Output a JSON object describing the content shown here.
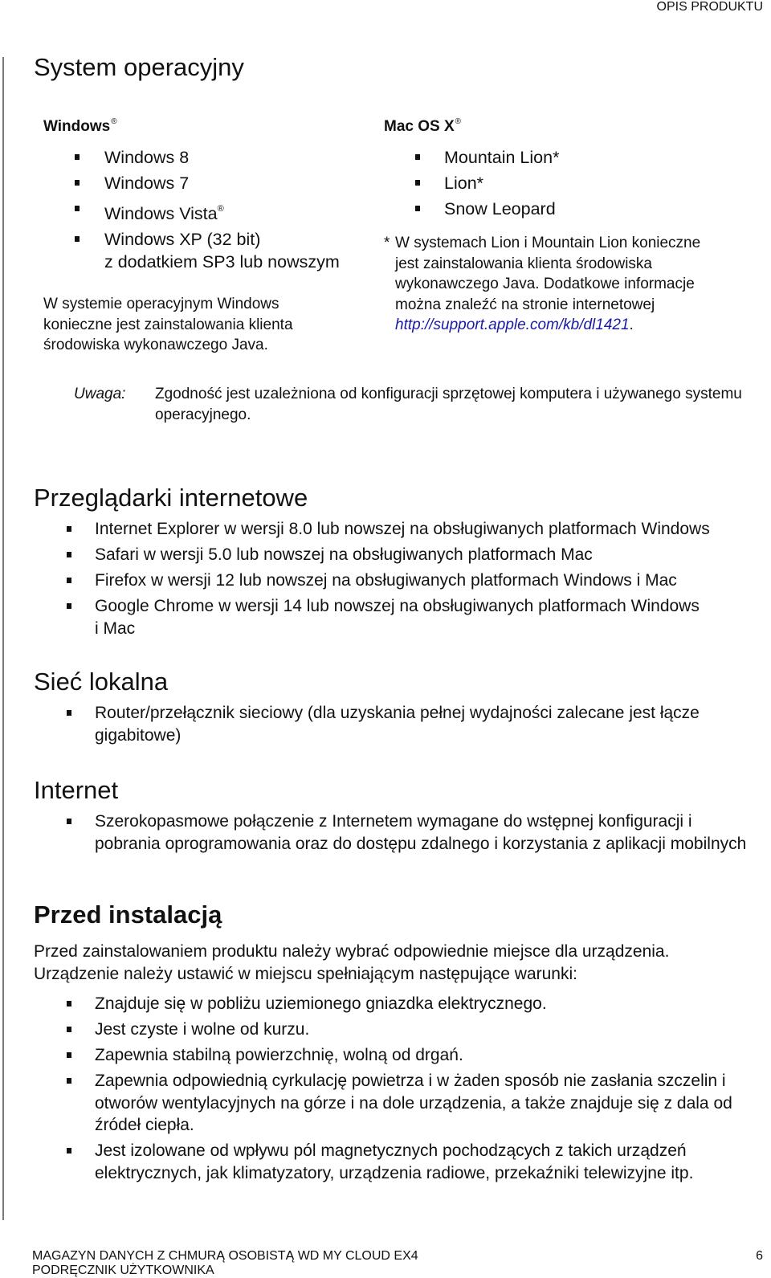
{
  "header": {
    "running_title": "OPIS PRODUKTU"
  },
  "sections": {
    "os": {
      "title": "System operacyjny",
      "windows": {
        "title": "Windows",
        "title_mark": "®",
        "items": [
          {
            "text": "Windows 8",
            "mark": ""
          },
          {
            "text": "Windows 7",
            "mark": ""
          },
          {
            "text": "Windows Vista",
            "mark": "®"
          },
          {
            "text": "Windows XP (32 bit)",
            "line2": "z dodatkiem SP3 lub nowszym",
            "mark": ""
          }
        ],
        "note_lines": [
          "W systemie operacyjnym Windows",
          "konieczne jest zainstalowania klienta",
          "środowiska wykonawczego Java."
        ]
      },
      "mac": {
        "title": "Mac OS X",
        "title_mark": "®",
        "items": [
          "Mountain Lion*",
          "Lion*",
          "Snow Leopard"
        ],
        "footnote_marker": "*",
        "footnote_lines": [
          "W systemach Lion i Mountain Lion konieczne",
          "jest zainstalowania klienta środowiska",
          "wykonawczego Java. Dodatkowe informacje",
          "można znaleźć na stronie internetowej"
        ],
        "link_text": "http://support.apple.com/kb/dl1421",
        "link_suffix": "."
      },
      "note": {
        "label": "Uwaga:",
        "text": "Zgodność jest uzależniona od konfiguracji sprzętowej komputera i używanego systemu operacyjnego."
      }
    },
    "browsers": {
      "title": "Przeglądarki internetowe",
      "items": [
        "Internet Explorer w wersji 8.0 lub nowszej na obsługiwanych platformach Windows",
        "Safari w wersji 5.0 lub nowszej na obsługiwanych platformach Mac",
        "Firefox w wersji 12 lub nowszej na obsługiwanych platformach Windows i Mac",
        "Google Chrome w wersji 14 lub nowszej na obsługiwanych platformach Windows i Mac"
      ]
    },
    "lan": {
      "title": "Sieć lokalna",
      "items": [
        "Router/przełącznik sieciowy (dla uzyskania pełnej wydajności zalecane jest łącze gigabitowe)"
      ]
    },
    "internet": {
      "title": "Internet",
      "items": [
        "Szerokopasmowe połączenie z Internetem wymagane do wstępnej konfiguracji i pobrania oprogramowania oraz do dostępu zdalnego i korzystania z aplikacji mobilnych"
      ]
    },
    "before_install": {
      "title": "Przed instalacją",
      "intro": "Przed zainstalowaniem produktu należy wybrać odpowiednie miejsce dla urządzenia. Urządzenie należy ustawić w miejscu spełniającym następujące warunki:",
      "items": [
        "Znajduje się w pobliżu uziemionego gniazdka elektrycznego.",
        "Jest czyste i wolne od kurzu.",
        "Zapewnia stabilną powierzchnię, wolną od drgań.",
        "Zapewnia odpowiednią cyrkulację powietrza i w żaden sposób nie zasłania szczelin i otworów wentylacyjnych na górze i na dole urządzenia, a także znajduje się z dala od źródeł ciepła.",
        "Jest izolowane od wpływu pól magnetycznych pochodzących z takich urządzeń elektrycznych, jak klimatyzatory, urządzenia radiowe, przekaźniki telewizyjne itp."
      ]
    }
  },
  "footer": {
    "product_line": "MAGAZYN DANYCH Z CHMURĄ OSOBISTĄ WD MY CLOUD EX4",
    "manual_line": "PODRĘCZNIK UŻYTKOWNIKA",
    "page_number": "6"
  }
}
